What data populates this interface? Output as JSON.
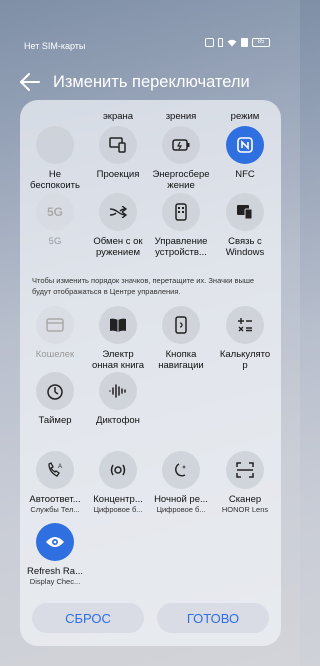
{
  "status_bar": {
    "carrier": "Нет SIM-карты",
    "battery": "85"
  },
  "header": {
    "title": "Изменить переключатели"
  },
  "top_cut_labels": [
    "экрана",
    "зрения",
    "режим"
  ],
  "active_tiles": [
    {
      "label1": "Не",
      "label2": "беспокоить",
      "icon": "moon-icon"
    },
    {
      "label1": "Проекция",
      "label2": "",
      "icon": "projection-icon"
    },
    {
      "label1": "Энергосбере",
      "label2": "жение",
      "icon": "battery-saver-icon"
    },
    {
      "label1": "NFC",
      "label2": "",
      "icon": "nfc-icon"
    },
    {
      "label1": "5G",
      "label2": "",
      "icon": "5g-icon"
    },
    {
      "label1": "Обмен с ок",
      "label2": "ружением",
      "icon": "share-icon"
    },
    {
      "label1": "Управление",
      "label2": "устройств...",
      "icon": "device-control-icon"
    },
    {
      "label1": "Связь с",
      "label2": "Windows",
      "icon": "windows-link-icon"
    }
  ],
  "hint": "Чтобы изменить порядок значков, перетащите их. Значки выше будут отображаться в Центре управления.",
  "inactive_tiles": [
    {
      "label1": "Кошелек",
      "label2": "",
      "icon": "wallet-icon"
    },
    {
      "label1": "Электр",
      "label2": "онная книга",
      "icon": "book-icon"
    },
    {
      "label1": "Кнопка",
      "label2": "навигации",
      "icon": "nav-button-icon"
    },
    {
      "label1": "Калькулято",
      "label2": "р",
      "icon": "calculator-icon"
    },
    {
      "label1": "Таймер",
      "label2": "",
      "icon": "timer-icon"
    },
    {
      "label1": "Диктофон",
      "label2": "",
      "icon": "recorder-icon"
    }
  ],
  "app_tiles": [
    {
      "label": "Автоответ...",
      "sub": "Службы Тел...",
      "icon": "auto-answer-icon"
    },
    {
      "label": "Концентр...",
      "sub": "Цифровое б...",
      "icon": "focus-icon"
    },
    {
      "label": "Ночной ре...",
      "sub": "Цифровое б...",
      "icon": "night-mode-icon"
    },
    {
      "label": "Сканер",
      "sub": "HONOR Lens",
      "icon": "scanner-icon"
    },
    {
      "label": "Refresh Ra...",
      "sub": "Display Chec...",
      "icon": "eye-icon"
    }
  ],
  "footer": {
    "reset": "СБРОС",
    "done": "ГОТОВО"
  }
}
